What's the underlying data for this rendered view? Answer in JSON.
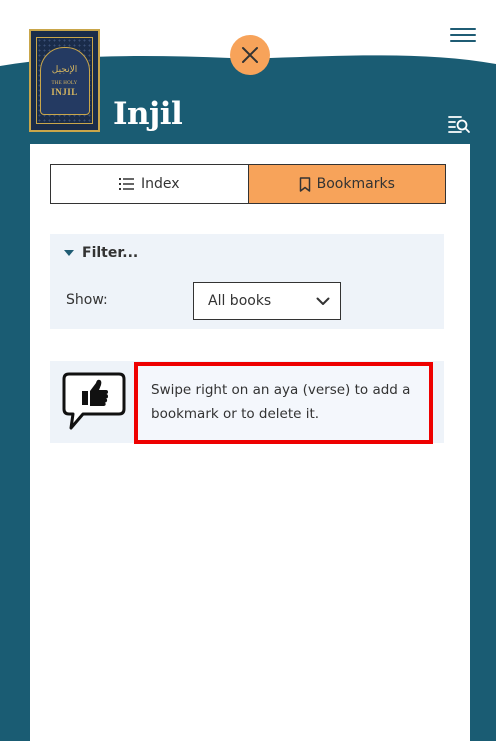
{
  "app": {
    "title": "Injil"
  },
  "cover": {
    "calligraphy": "الإنجيل",
    "small_text": "THE HOLY",
    "big_text": "INJIL"
  },
  "header": {
    "menu_icon": "hamburger-menu-icon",
    "close_icon": "close-icon",
    "search_list_icon": "list-search-icon"
  },
  "tabs": [
    {
      "label": "Index",
      "icon": "list-icon",
      "active": false
    },
    {
      "label": "Bookmarks",
      "icon": "bookmark-icon",
      "active": true
    }
  ],
  "filter": {
    "toggle_label": "Filter...",
    "show_label": "Show:",
    "selected_option": "All books"
  },
  "hint": {
    "icon": "thumbs-up-speech-bubble-icon",
    "text": "Swipe right on an aya (verse) to add a bookmark or to delete it."
  },
  "colors": {
    "teal": "#1a5c73",
    "orange": "#f7a35a",
    "panel_bg": "#eef3f9",
    "highlight_red": "#ee0000"
  }
}
